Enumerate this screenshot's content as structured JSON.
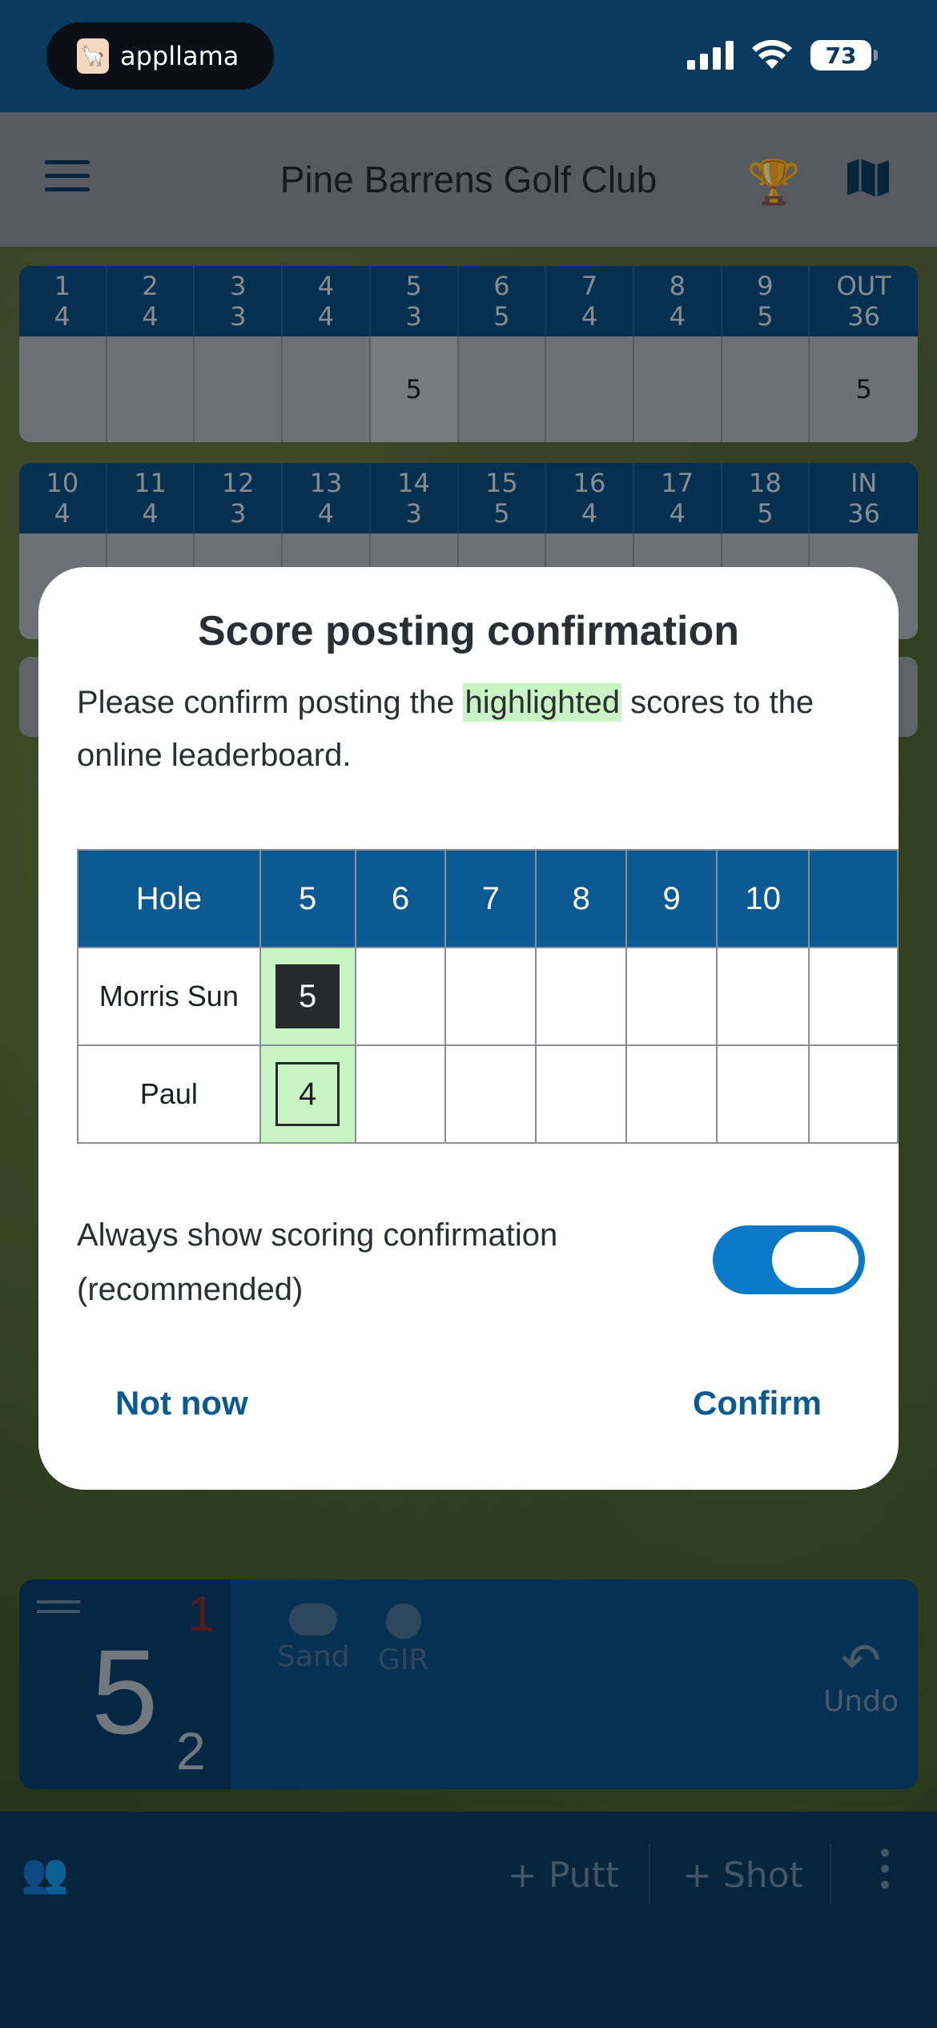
{
  "status_bar": {
    "app_pill_label": "appllama",
    "battery": "73"
  },
  "header": {
    "title": "Pine Barrens Golf Club"
  },
  "scorecard_front": {
    "holes": [
      {
        "hole": "1",
        "par": "4"
      },
      {
        "hole": "2",
        "par": "4"
      },
      {
        "hole": "3",
        "par": "3"
      },
      {
        "hole": "4",
        "par": "4"
      },
      {
        "hole": "5",
        "par": "3"
      },
      {
        "hole": "6",
        "par": "5"
      },
      {
        "hole": "7",
        "par": "4"
      },
      {
        "hole": "8",
        "par": "4"
      },
      {
        "hole": "9",
        "par": "5"
      }
    ],
    "total_label": "OUT",
    "total_par": "36",
    "scores": [
      "",
      "",
      "",
      "",
      "5",
      "",
      "",
      "",
      ""
    ],
    "total_score": "5"
  },
  "scorecard_back": {
    "holes": [
      {
        "hole": "10",
        "par": "4"
      },
      {
        "hole": "11",
        "par": "4"
      },
      {
        "hole": "12",
        "par": "3"
      },
      {
        "hole": "13",
        "par": "4"
      },
      {
        "hole": "14",
        "par": "3"
      },
      {
        "hole": "15",
        "par": "5"
      },
      {
        "hole": "16",
        "par": "4"
      },
      {
        "hole": "17",
        "par": "4"
      },
      {
        "hole": "18",
        "par": "5"
      }
    ],
    "total_label": "IN",
    "total_par": "36"
  },
  "modal": {
    "title": "Score posting confirmation",
    "text_before": "Please confirm posting the ",
    "text_highlight": "highlighted",
    "text_after": " scores to the online leaderboard.",
    "table": {
      "header_label": "Hole",
      "holes": [
        "5",
        "6",
        "7",
        "8",
        "9",
        "10"
      ],
      "players": [
        {
          "name": "Morris Sun",
          "scores": [
            "5",
            "",
            "",
            "",
            "",
            ""
          ]
        },
        {
          "name": "Paul",
          "scores": [
            "4",
            "",
            "",
            "",
            "",
            ""
          ]
        }
      ]
    },
    "toggle_label": "Always show scoring confirmation (recommended)",
    "toggle_on": true,
    "cancel_label": "Not now",
    "confirm_label": "Confirm"
  },
  "score_panel": {
    "big_score": "5",
    "red_number": "1",
    "putts": "2",
    "sand_label": "Sand",
    "gir_label": "GIR",
    "undo_label": "Undo"
  },
  "bottom_bar": {
    "putt_label": "+ Putt",
    "shot_label": "+ Shot"
  },
  "colors": {
    "navy": "#0b3a5f",
    "primary_blue": "#0b5a93",
    "highlight_green": "#c9f5c5",
    "toggle_blue": "#0b79c8"
  }
}
